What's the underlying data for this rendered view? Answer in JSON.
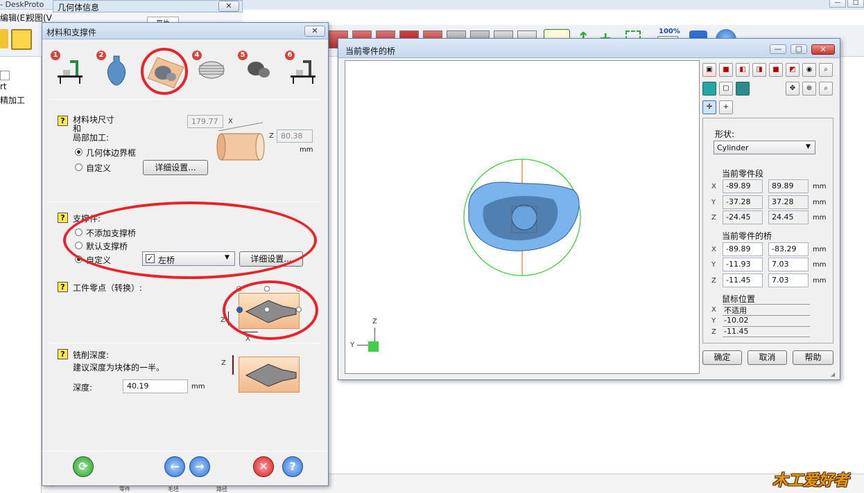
{
  "background_app": {
    "title_fragment": "- DeskProto",
    "menu_edit": "编辑(E)",
    "menu_view": "视图(V",
    "geometry_info_title": "几何体信息",
    "tab_label": "平片",
    "zoom_label": "100%",
    "left_items": [
      "rt",
      "精加工"
    ],
    "bottom_labels": [
      "零件",
      "毛坯",
      "路径"
    ]
  },
  "dialog_material": {
    "title": "材料和支撑件",
    "step_numbers": [
      "1",
      "2",
      "3",
      "4",
      "5",
      "6"
    ],
    "selected_step": 3,
    "block_size": {
      "label_line1": "材料块尺寸",
      "label_line2": "和",
      "label_line3": "局部加工:",
      "option_bbox": "几何体边界框",
      "option_custom": "自定义",
      "selected": "几何体边界框",
      "details_button": "详细设置...",
      "x_value": "179.77",
      "x_label": "X",
      "z_value": "80.38",
      "z_label": "Z",
      "unit": "mm"
    },
    "supports": {
      "label": "支撑件:",
      "option_none": "不添加支撑桥",
      "option_default": "默认支撑桥",
      "option_custom": "自定义",
      "selected": "自定义",
      "dropdown_value": "左桥",
      "dropdown_checked": true,
      "details_button": "详细设置..."
    },
    "zero_point": {
      "label": "工件零点（转换）:",
      "axis_z": "Z",
      "axis_x": "X"
    },
    "milling_depth": {
      "label": "铣削深度:",
      "hint": "建议深度为块体的一半。",
      "depth_label": "深度:",
      "depth_value": "40.19",
      "unit": "mm",
      "axis_z": "Z"
    },
    "help_symbol": "?",
    "close_symbol": "✕",
    "footer_icons": [
      "refresh-icon",
      "back-icon",
      "next-icon",
      "cancel-icon",
      "help-icon"
    ]
  },
  "dialog_bridge": {
    "title": "当前零件的桥",
    "shape_label": "形状:",
    "shape_value": "Cylinder",
    "current_segment": {
      "label": "当前零件段",
      "rows": [
        {
          "axis": "X",
          "min": "-89.89",
          "max": "89.89",
          "unit": "mm"
        },
        {
          "axis": "Y",
          "min": "-37.28",
          "max": "37.28",
          "unit": "mm"
        },
        {
          "axis": "Z",
          "min": "-24.45",
          "max": "24.45",
          "unit": "mm"
        }
      ]
    },
    "current_bridge": {
      "label": "当前零件的桥",
      "rows": [
        {
          "axis": "X",
          "min": "-89.89",
          "max": "-83.29",
          "unit": "mm"
        },
        {
          "axis": "Y",
          "min": "-11.93",
          "max": "7.03",
          "unit": "mm"
        },
        {
          "axis": "Z",
          "min": "-11.45",
          "max": "7.03",
          "unit": "mm"
        }
      ]
    },
    "mouse_position": {
      "label": "鼠标位置",
      "rows": [
        {
          "axis": "X",
          "value": "不适用"
        },
        {
          "axis": "Y",
          "value": "-10.02"
        },
        {
          "axis": "Z",
          "value": "-11.45"
        }
      ]
    },
    "viewport_axes": {
      "y": "Y",
      "z": "Z"
    },
    "buttons": {
      "ok": "确定",
      "cancel": "取消",
      "help": "帮助"
    }
  },
  "watermark": "木工爱好者"
}
